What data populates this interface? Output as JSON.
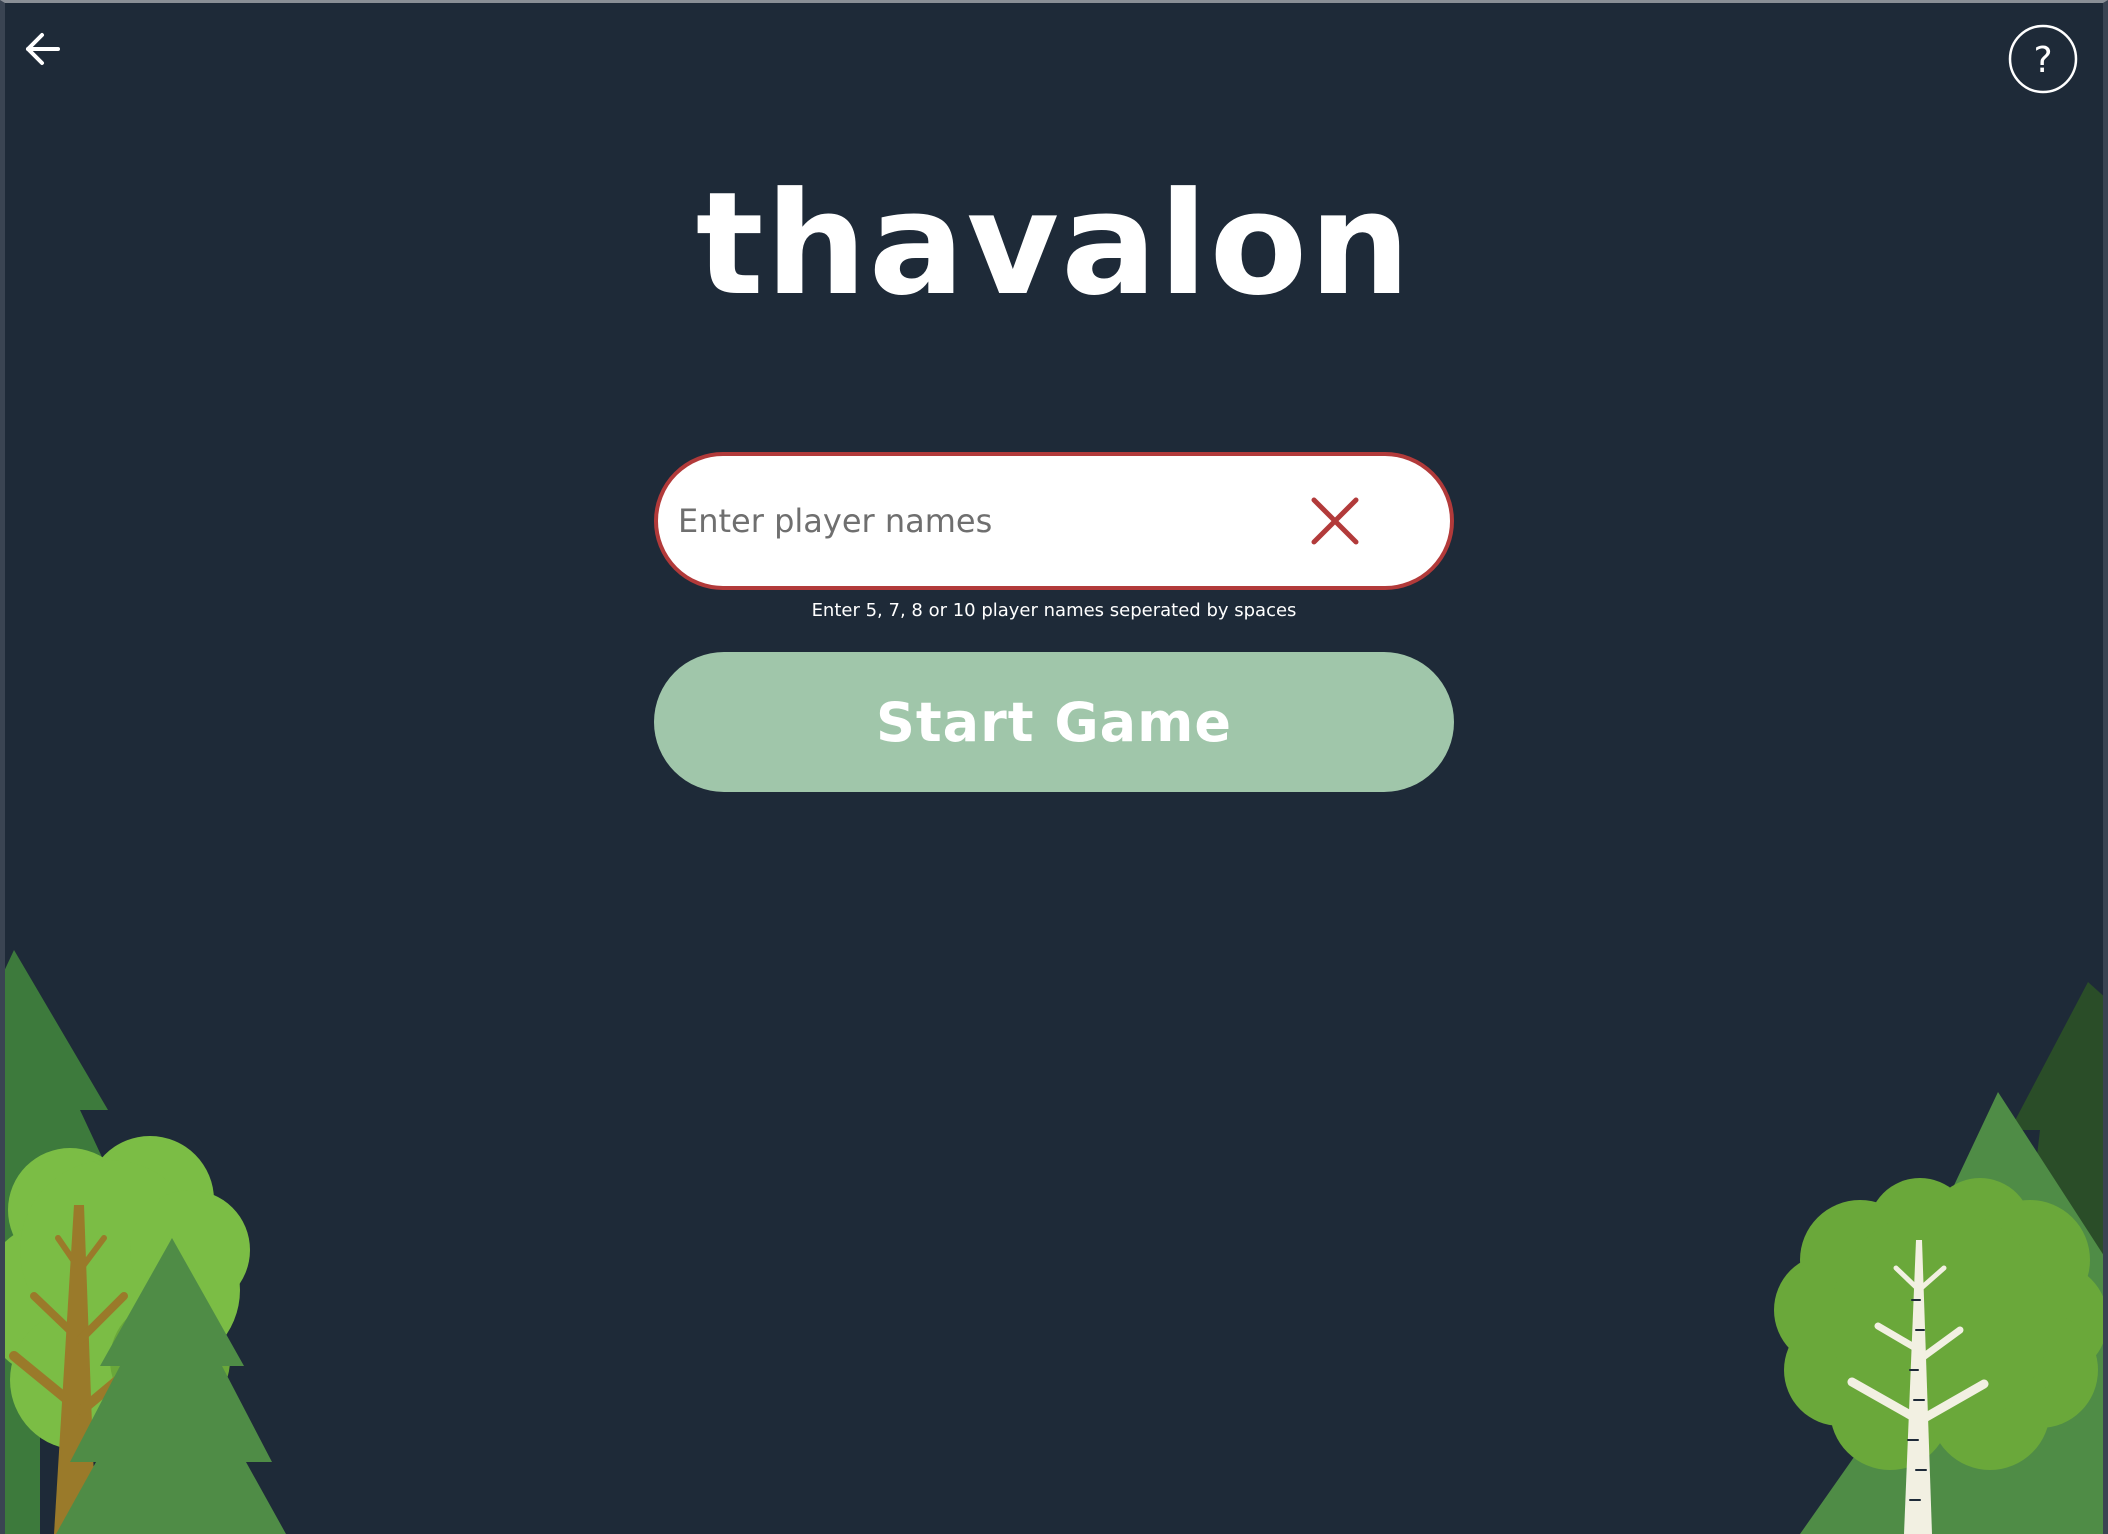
{
  "app": {
    "title": "thavalon"
  },
  "nav": {
    "back_icon": "arrow-left-icon",
    "help_icon": "question-mark-circle-icon",
    "help_glyph": "?"
  },
  "player_input": {
    "value": "",
    "placeholder": "Enter player names",
    "clear_icon": "close-x-icon",
    "helper_text": "Enter 5, 7, 8 or 10 player names seperated by spaces",
    "error_color": "#b23a3a"
  },
  "start_button": {
    "label": "Start Game",
    "color": "#a0c6aa"
  },
  "colors": {
    "background": "#1e2a38",
    "pine_dark": "#2f6b36",
    "pine_mid": "#4f8c46",
    "leaf_light": "#7bbd45",
    "leaf_mid": "#6aa83a",
    "trunk_brown": "#9a7a2a",
    "birch_white": "#f2f0e2"
  }
}
